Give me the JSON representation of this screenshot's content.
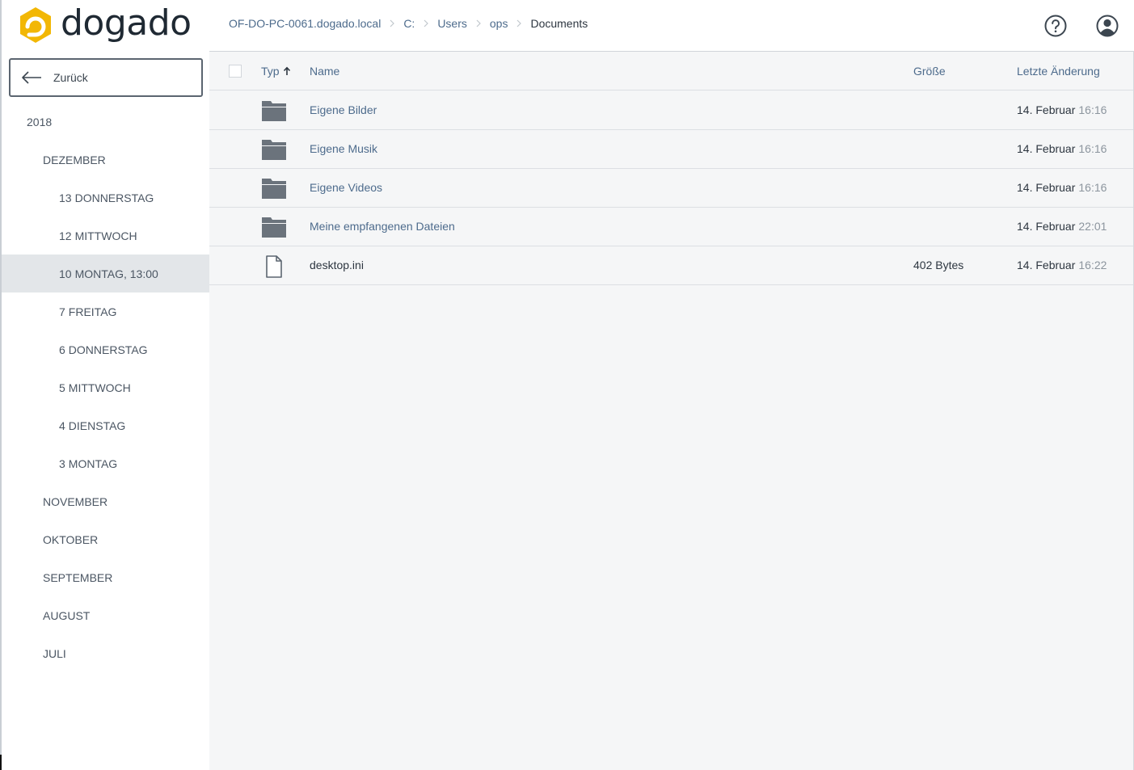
{
  "app": {
    "brand": "dogado",
    "colors": {
      "brand_yellow": "#f2b705",
      "link": "#4d6b8c",
      "selected_bg": "#e3e6e9",
      "folder_icon": "#6b737c"
    }
  },
  "sidebar": {
    "back_label": "Zurück",
    "tree": [
      {
        "level": 0,
        "num": "",
        "label": "2018",
        "selected": false
      },
      {
        "level": 1,
        "num": "",
        "label": "DEZEMBER",
        "selected": false
      },
      {
        "level": 2,
        "num": "13",
        "label": "DONNERSTAG",
        "selected": false
      },
      {
        "level": 2,
        "num": "12",
        "label": "MITTWOCH",
        "selected": false
      },
      {
        "level": 2,
        "num": "10",
        "label": "MONTAG, 13:00",
        "selected": true
      },
      {
        "level": 2,
        "num": "7",
        "label": "FREITAG",
        "selected": false
      },
      {
        "level": 2,
        "num": "6",
        "label": "DONNERSTAG",
        "selected": false
      },
      {
        "level": 2,
        "num": "5",
        "label": "MITTWOCH",
        "selected": false
      },
      {
        "level": 2,
        "num": "4",
        "label": "DIENSTAG",
        "selected": false
      },
      {
        "level": 2,
        "num": "3",
        "label": "MONTAG",
        "selected": false
      },
      {
        "level": 1,
        "num": "",
        "label": "NOVEMBER",
        "selected": false
      },
      {
        "level": 1,
        "num": "",
        "label": "OKTOBER",
        "selected": false
      },
      {
        "level": 1,
        "num": "",
        "label": "SEPTEMBER",
        "selected": false
      },
      {
        "level": 1,
        "num": "",
        "label": "AUGUST",
        "selected": false
      },
      {
        "level": 1,
        "num": "",
        "label": "JULI",
        "selected": false
      }
    ]
  },
  "header": {
    "breadcrumb": [
      "OF-DO-PC-0061.dogado.local",
      "C:",
      "Users",
      "ops",
      "Documents"
    ],
    "help_icon": "help-circle-icon",
    "user_icon": "user-circle-icon"
  },
  "table": {
    "columns": {
      "type": "Typ",
      "name": "Name",
      "size": "Größe",
      "modified": "Letzte Änderung"
    },
    "sort": {
      "column": "type",
      "direction": "asc",
      "icon": "arrow-up-icon"
    },
    "rows": [
      {
        "kind": "folder",
        "name": "Eigene Bilder",
        "size": "",
        "date": "14. Februar",
        "time": "16:16"
      },
      {
        "kind": "folder",
        "name": "Eigene Musik",
        "size": "",
        "date": "14. Februar",
        "time": "16:16"
      },
      {
        "kind": "folder",
        "name": "Eigene Videos",
        "size": "",
        "date": "14. Februar",
        "time": "16:16"
      },
      {
        "kind": "folder",
        "name": "Meine empfangenen Dateien",
        "size": "",
        "date": "14. Februar",
        "time": "22:01"
      },
      {
        "kind": "file",
        "name": "desktop.ini",
        "size": "402 Bytes",
        "date": "14. Februar",
        "time": "16:22"
      }
    ]
  }
}
